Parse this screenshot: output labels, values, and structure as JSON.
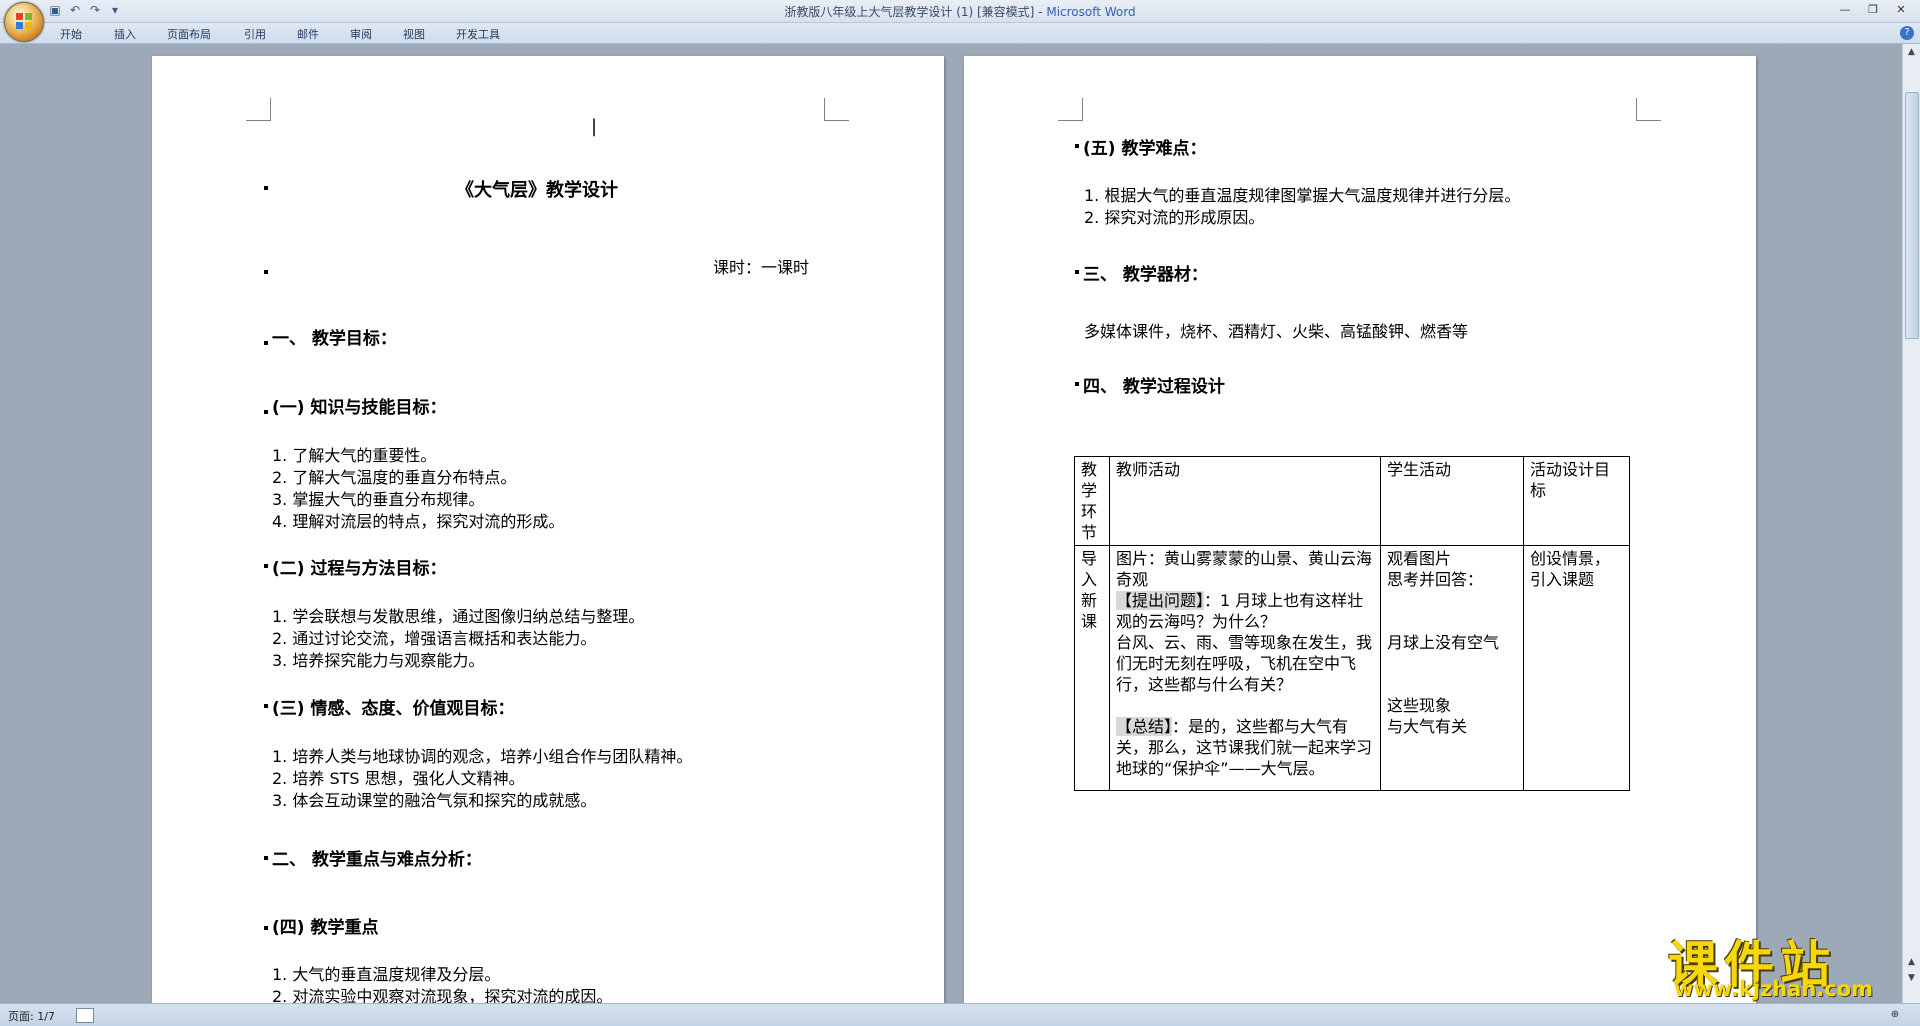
{
  "window": {
    "title": "浙教版八年级上大气层教学设计 (1) [兼容模式]",
    "app_name": "Microsoft Word"
  },
  "qat_icons": [
    "save-icon",
    "undo-icon",
    "redo-icon",
    "customize-icon"
  ],
  "ribbon": {
    "tabs": [
      "开始",
      "插入",
      "页面布局",
      "引用",
      "邮件",
      "审阅",
      "视图",
      "开发工具"
    ]
  },
  "page1": {
    "title": "《大气层》教学设计",
    "period": "课时：一课时",
    "s1": "一、 教学目标：",
    "s1a": "(一) 知识与技能目标：",
    "s1a_items": [
      "1. 了解大气的重要性。",
      "2. 了解大气温度的垂直分布特点。",
      "3. 掌握大气的垂直分布规律。",
      "4. 理解对流层的特点，探究对流的形成。"
    ],
    "s1b": "(二) 过程与方法目标：",
    "s1b_items": [
      "1. 学会联想与发散思维，通过图像归纳总结与整理。",
      "2. 通过讨论交流，增强语言概括和表达能力。",
      "3. 培养探究能力与观察能力。"
    ],
    "s1c": "(三) 情感、态度、价值观目标：",
    "s1c_items": [
      "1. 培养人类与地球协调的观念，培养小组合作与团队精神。",
      "2. 培养 STS 思想，强化人文精神。",
      "3. 体会互动课堂的融洽气氛和探究的成就感。"
    ],
    "s2": "二、 教学重点与难点分析：",
    "s2a": "(四) 教学重点",
    "s2a_items": [
      "1. 大气的垂直温度规律及分层。",
      "2. 对流实验中观察对流现象，探究对流的成因。"
    ]
  },
  "page2": {
    "s2b": "(五) 教学难点：",
    "s2b_items": [
      "1. 根据大气的垂直温度规律图掌握大气温度规律并进行分层。",
      "2. 探究对流的形成原因。"
    ],
    "s3": "三、 教学器材：",
    "s3_text": "多媒体课件，烧杯、酒精灯、火柴、高锰酸钾、燃香等",
    "s4": "四、 教学过程设计",
    "table": {
      "headers": [
        "教学环节",
        "教师活动",
        "学生活动",
        "活动设计目标"
      ],
      "row1_stage": "导入新课",
      "teacher": {
        "l1": "图片：黄山雾蒙蒙的山景、黄山云海奇观",
        "tag1": "【提出问题】",
        "q1": "：1 月球上也有这样壮观的云海吗？为什么？",
        "q2": "台风、云、雨、雪等现象在发生，我们无时无刻在呼吸，飞机在空中飞行，这些都与什么有关？",
        "tag2": "【总结】",
        "sum": "：是的，这些都与大气有关，那么，这节课我们就一起来学习地球的“保护伞”——大气层。"
      },
      "student": {
        "s1": "观看图片",
        "s2": "思考并回答：",
        "s3": "月球上没有空气",
        "s4": "这些现象",
        "s5": "与大气有关"
      },
      "goal": {
        "g1": "创设情景，",
        "g2": "引入课题"
      }
    }
  },
  "status": {
    "page": "页面: 1/7"
  },
  "watermark": {
    "name": "课件站",
    "url": "www.kjzhan.com"
  }
}
